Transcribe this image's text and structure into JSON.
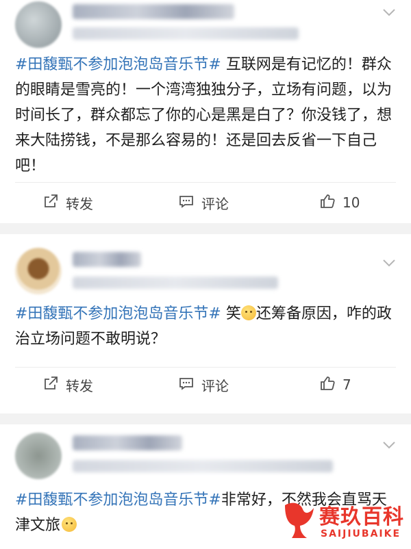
{
  "posts": [
    {
      "topic": "#田馥甄不参加泡泡岛音乐节#",
      "body": " 互联网是有记忆的！群众的眼睛是雪亮的！一个湾湾独独分子，立场有问题，以为时间长了，群众都忘了你的心是黑是白了？你没钱了，想来大陆捞钱，不是那么容易的！还是回去反省一下自己吧！",
      "repost_label": "转发",
      "comment_label": "评论",
      "like_count": "10"
    },
    {
      "topic": "#田馥甄不参加泡泡岛音乐节#",
      "body_before_emoji": " 笑",
      "body_after_emoji": "还筹备原因，咋的政治立场问题不敢明说？",
      "repost_label": "转发",
      "comment_label": "评论",
      "like_count": "7"
    },
    {
      "topic": "#田馥甄不参加泡泡岛音乐节#",
      "body": "非常好，不然我会直骂天津文旅"
    }
  ],
  "watermark": {
    "cn": "赛玖百科",
    "en": "SAIJIUBAIKE"
  },
  "colors": {
    "topic": "#3474b8",
    "watermark": "#e8362b"
  },
  "icons": [
    "chevron-down-icon",
    "repost-icon",
    "comment-icon",
    "like-icon",
    "emoji-icon"
  ]
}
